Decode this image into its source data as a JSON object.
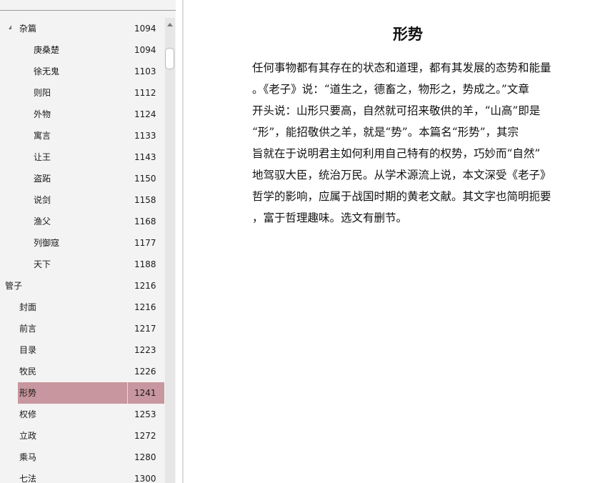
{
  "toc": {
    "items": [
      {
        "title": "杂篇",
        "page": "1094",
        "level": 1,
        "expanded": true
      },
      {
        "title": "庚桑楚",
        "page": "1094",
        "level": 2
      },
      {
        "title": "徐无鬼",
        "page": "1103",
        "level": 2
      },
      {
        "title": "则阳",
        "page": "1112",
        "level": 2
      },
      {
        "title": "外物",
        "page": "1124",
        "level": 2
      },
      {
        "title": "寓言",
        "page": "1133",
        "level": 2
      },
      {
        "title": "让王",
        "page": "1143",
        "level": 2
      },
      {
        "title": "盗跖",
        "page": "1150",
        "level": 2
      },
      {
        "title": "说剑",
        "page": "1158",
        "level": 2
      },
      {
        "title": "渔父",
        "page": "1168",
        "level": 2
      },
      {
        "title": "列御寇",
        "page": "1177",
        "level": 2
      },
      {
        "title": "天下",
        "page": "1188",
        "level": 2
      },
      {
        "title": "管子",
        "page": "1216",
        "level": 0
      },
      {
        "title": "封面",
        "page": "1216",
        "level": 1
      },
      {
        "title": "前言",
        "page": "1217",
        "level": 1
      },
      {
        "title": "目录",
        "page": "1223",
        "level": 1
      },
      {
        "title": "牧民",
        "page": "1226",
        "level": 1
      },
      {
        "title": "形势",
        "page": "1241",
        "level": 1,
        "selected": true
      },
      {
        "title": "权修",
        "page": "1253",
        "level": 1
      },
      {
        "title": "立政",
        "page": "1272",
        "level": 1
      },
      {
        "title": "乘马",
        "page": "1280",
        "level": 1
      },
      {
        "title": "七法",
        "page": "1300",
        "level": 1
      }
    ]
  },
  "article": {
    "title": "形势",
    "lines": [
      "任何事物都有其存在的状态和道理，都有其发展的态势和能量",
      "。《老子》说：“道生之，德畜之，物形之，势成之。”文章",
      "开头说：山形只要高，自然就可招来敬供的羊，“山高”即是",
      "“形”，能招敬供之羊，就是“势”。本篇名“形势”，其宗",
      "旨就在于说明君主如何利用自己特有的权势，巧妙而“自然”",
      "地驾驭大臣，统治万民。从学术源流上说，本文深受《老子》",
      "哲学的影响，应属于战国时期的黄老文献。其文字也简明扼要",
      "，富于哲理趣味。选文有删节。"
    ]
  },
  "colors": {
    "selected_row": "#c8969e",
    "sidebar_bg": "#f3f3f3"
  }
}
